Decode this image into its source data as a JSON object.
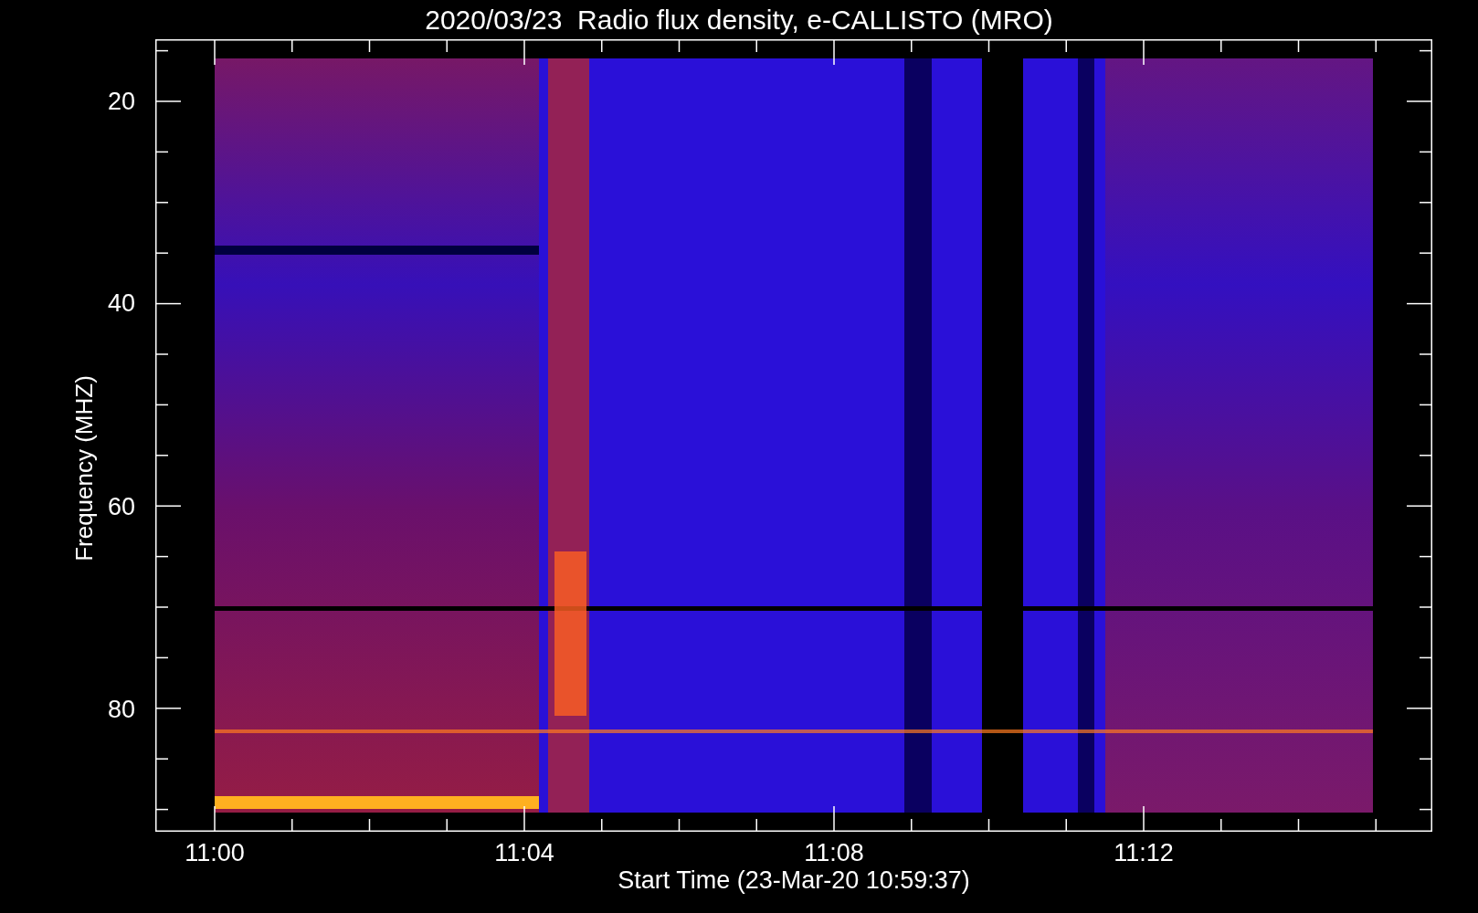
{
  "title": "2020/03/23  Radio flux density, e-CALLISTO (MRO)",
  "ylabel": "Frequency (MHZ)",
  "yticks": [
    "20",
    "40",
    "60",
    "80"
  ],
  "xticks": [
    "11:00",
    "11:04",
    "11:08",
    "11:12"
  ],
  "xlabel": "Start Time (23-Mar-20 10:59:37)"
}
